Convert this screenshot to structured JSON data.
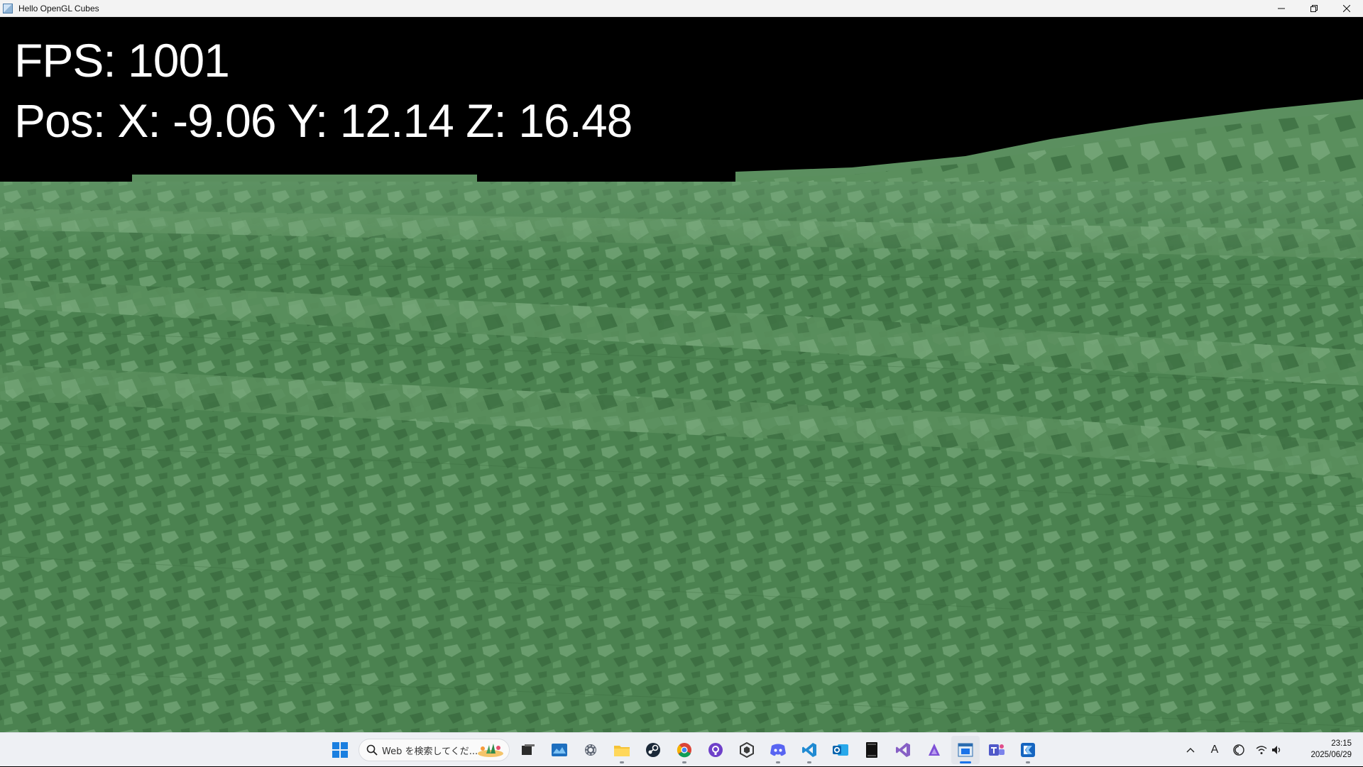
{
  "window": {
    "title": "Hello OpenGL Cubes",
    "controls": {
      "minimize": "minimize-icon",
      "maximize": "restore-icon",
      "close": "close-icon"
    }
  },
  "hud": {
    "fps_text": "FPS: 1001",
    "pos_text": "Pos: X: -9.06 Y: 12.14 Z: 16.48"
  },
  "scene": {
    "sky_color": "#000000",
    "ground_dark": "#3f7244",
    "ground_mid": "#4f8655",
    "ground_light": "#6a9d6e"
  },
  "taskbar": {
    "search": {
      "placeholder": "Web を検索してくだ...",
      "icon": "search-icon"
    },
    "apps": [
      {
        "name": "start",
        "icon": "windows-logo-icon",
        "active": false
      },
      {
        "name": "task-view",
        "icon": "task-view-icon",
        "active": false
      },
      {
        "name": "widgets",
        "icon": "widgets-icon",
        "active": false
      },
      {
        "name": "settings",
        "icon": "gear-icon",
        "active": false
      },
      {
        "name": "file-explorer",
        "icon": "folder-icon",
        "active": false
      },
      {
        "name": "steam",
        "icon": "steam-icon",
        "active": false
      },
      {
        "name": "chrome",
        "icon": "chrome-icon",
        "active": false
      },
      {
        "name": "github-desktop",
        "icon": "github-icon",
        "active": false
      },
      {
        "name": "unity-hub",
        "icon": "unity-icon",
        "active": false
      },
      {
        "name": "discord",
        "icon": "discord-icon",
        "active": false
      },
      {
        "name": "vscode",
        "icon": "vscode-icon",
        "active": false
      },
      {
        "name": "outlook",
        "icon": "outlook-icon",
        "active": false
      },
      {
        "name": "terminal",
        "icon": "terminal-icon",
        "active": false
      },
      {
        "name": "visual-studio",
        "icon": "visual-studio-icon",
        "active": false
      },
      {
        "name": "affinity",
        "icon": "affinity-icon",
        "active": false
      },
      {
        "name": "hello-opengl-cubes",
        "icon": "opengl-app-icon",
        "active": true
      },
      {
        "name": "teams",
        "icon": "teams-icon",
        "active": false
      },
      {
        "name": "kotlin-app",
        "icon": "kotlin-icon",
        "active": false
      }
    ],
    "tray": {
      "chevron": "^",
      "ime": "A",
      "clock_time": "23:15",
      "clock_date": "2025/06/29"
    }
  }
}
